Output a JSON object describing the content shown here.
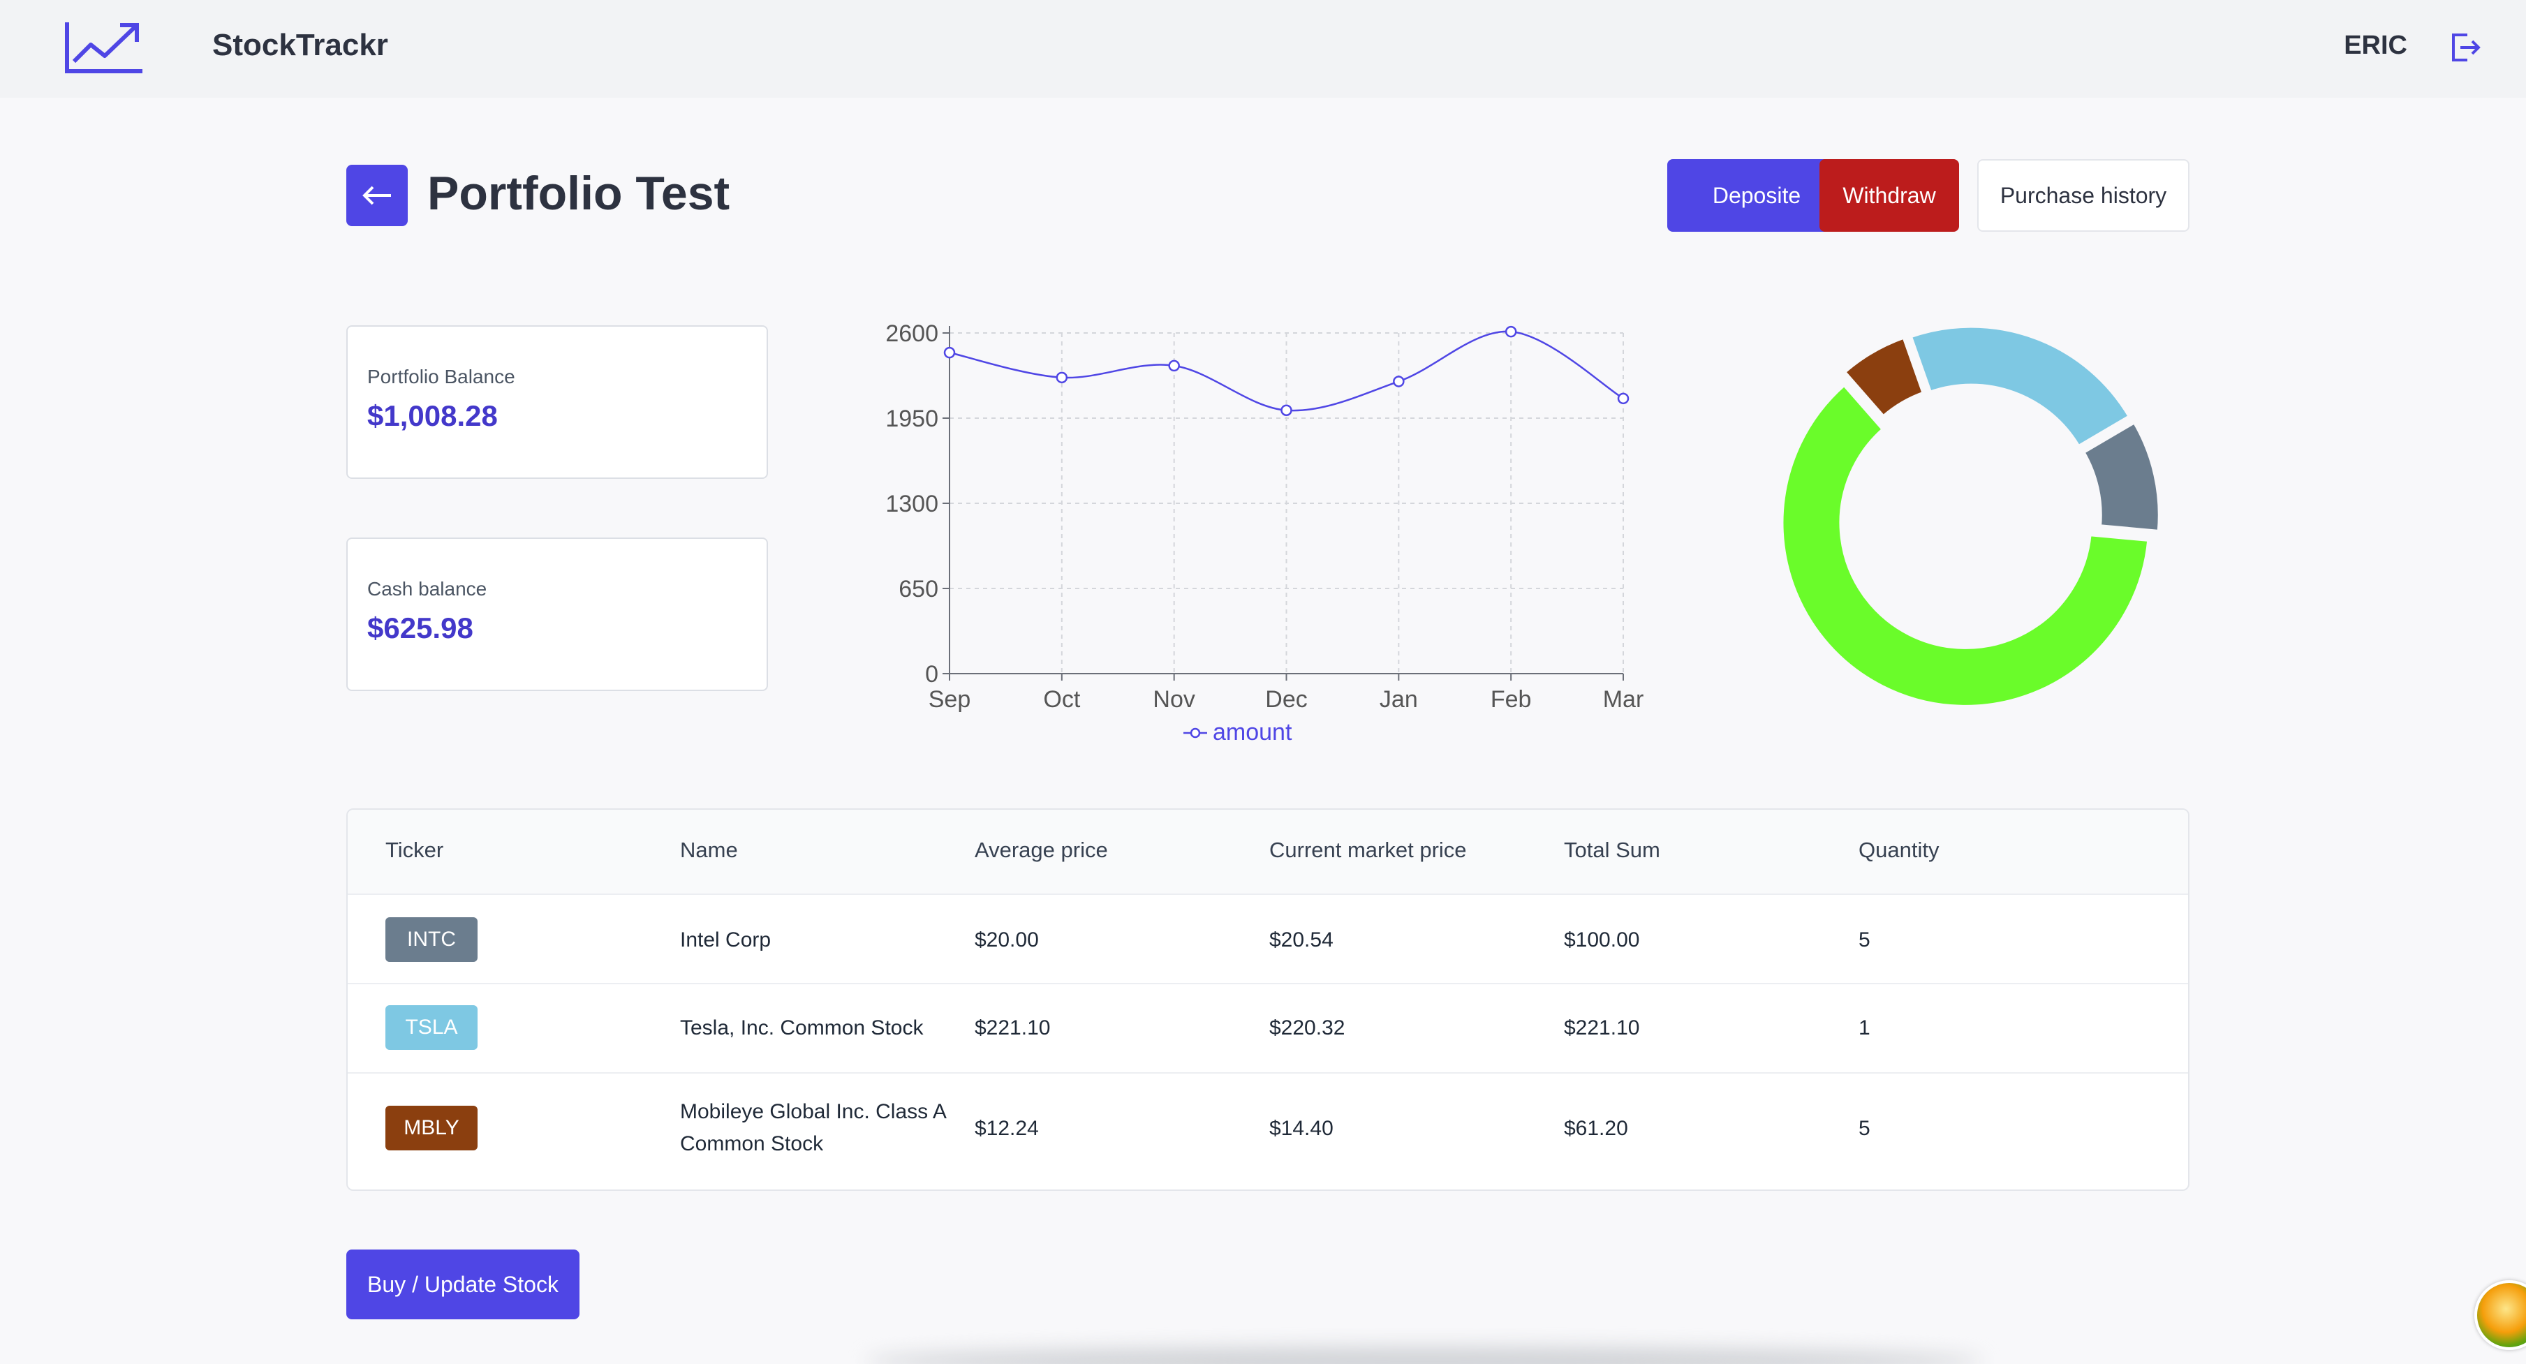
{
  "app": {
    "title": "StockTrackr",
    "logo_icon": "trending-up-icon",
    "user": "ERIC",
    "logout_icon": "logout-icon"
  },
  "page": {
    "title": "Portfolio Test",
    "back_icon": "arrow-left-icon"
  },
  "actions": {
    "deposit": "Deposite",
    "withdraw": "Withdraw",
    "history": "Purchase history",
    "buy": "Buy / Update Stock"
  },
  "cards": {
    "portfolio": {
      "label": "Portfolio Balance",
      "value": "$1,008.28"
    },
    "cash": {
      "label": "Cash balance",
      "value": "$625.98"
    }
  },
  "colors": {
    "accent": "#4f46e5",
    "danger": "#bc1c1c",
    "value_text": "#4338ca"
  },
  "table": {
    "headers": [
      "Ticker",
      "Name",
      "Average price",
      "Current market price",
      "Total Sum",
      "Quantity"
    ],
    "rows": [
      {
        "ticker": "INTC",
        "name": "Intel Corp",
        "avg": "$20.00",
        "current": "$20.54",
        "total": "$100.00",
        "qty": "5",
        "color": "#6b7d8e"
      },
      {
        "ticker": "TSLA",
        "name": "Tesla, Inc. Common Stock",
        "avg": "$221.10",
        "current": "$220.32",
        "total": "$221.10",
        "qty": "1",
        "color": "#7ec8e3"
      },
      {
        "ticker": "MBLY",
        "name": "Mobileye Global Inc. Class A Common Stock",
        "avg": "$12.24",
        "current": "$14.40",
        "total": "$61.20",
        "qty": "5",
        "color": "#8b3f0f"
      }
    ]
  },
  "chart_data": [
    {
      "type": "line",
      "categories": [
        "Sep",
        "Oct",
        "Nov",
        "Dec",
        "Jan",
        "Feb",
        "Mar"
      ],
      "series": [
        {
          "name": "amount",
          "values": [
            2450,
            2260,
            2350,
            2010,
            2230,
            2610,
            2100
          ],
          "color": "#4f46e5"
        }
      ],
      "ylim": [
        0,
        2600
      ],
      "yticks": [
        0,
        650,
        1300,
        1950,
        2600
      ],
      "grid": true,
      "legend": "bottom"
    },
    {
      "type": "pie",
      "style": "donut",
      "slices": [
        {
          "value": 61.2,
          "color": "#8b3f0f"
        },
        {
          "value": 221.1,
          "color": "#7ec8e3"
        },
        {
          "value": 100.0,
          "color": "#6b7d8e"
        },
        {
          "value": 625.98,
          "color": "#6afc2a"
        }
      ]
    }
  ]
}
